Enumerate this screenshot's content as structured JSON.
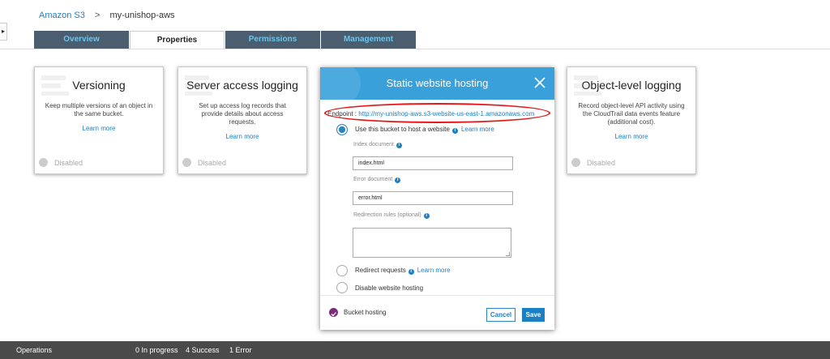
{
  "breadcrumb": {
    "root": "Amazon S3",
    "separator": ">",
    "current": "my-unishop-aws"
  },
  "tabs": [
    {
      "label": "Overview"
    },
    {
      "label": "Properties"
    },
    {
      "label": "Permissions"
    },
    {
      "label": "Management"
    }
  ],
  "cards": {
    "versioning": {
      "title": "Versioning",
      "desc": "Keep multiple versions of an object in the same bucket.",
      "link": "Learn more",
      "status": "Disabled"
    },
    "logging": {
      "title": "Server access logging",
      "desc": "Set up access log records that provide details about access requests.",
      "link": "Learn more",
      "status": "Disabled"
    },
    "object_logging": {
      "title": "Object-level logging",
      "desc": "Record object-level API activity using the CloudTrail data events feature (additional cost).",
      "link": "Learn more",
      "status": "Disabled"
    }
  },
  "modal": {
    "title": "Static website hosting",
    "endpoint_label": "Endpoint :",
    "endpoint_url": "http://my-unishop-aws.s3-website-us-east-1.amazonaws.com",
    "option_use": "Use this bucket to host a website",
    "option_use_link": "Learn more",
    "index_label": "Index document",
    "index_value": "index.html",
    "error_label": "Error document",
    "error_value": "error.html",
    "redirection_label": "Redirection rules (optional)",
    "option_redirect": "Redirect requests",
    "option_redirect_link": "Learn more",
    "option_disable": "Disable website hosting",
    "footer_status": "Bucket hosting",
    "cancel": "Cancel",
    "save": "Save"
  },
  "statusbar": {
    "label": "Operations",
    "in_progress": "0 In progress",
    "success": "4 Success",
    "error": "1 Error"
  },
  "colors": {
    "accent": "#1b7fc4",
    "header": "#3aa0d9",
    "tab_bg": "#4a5e6f",
    "annotation": "#e21a1a"
  }
}
